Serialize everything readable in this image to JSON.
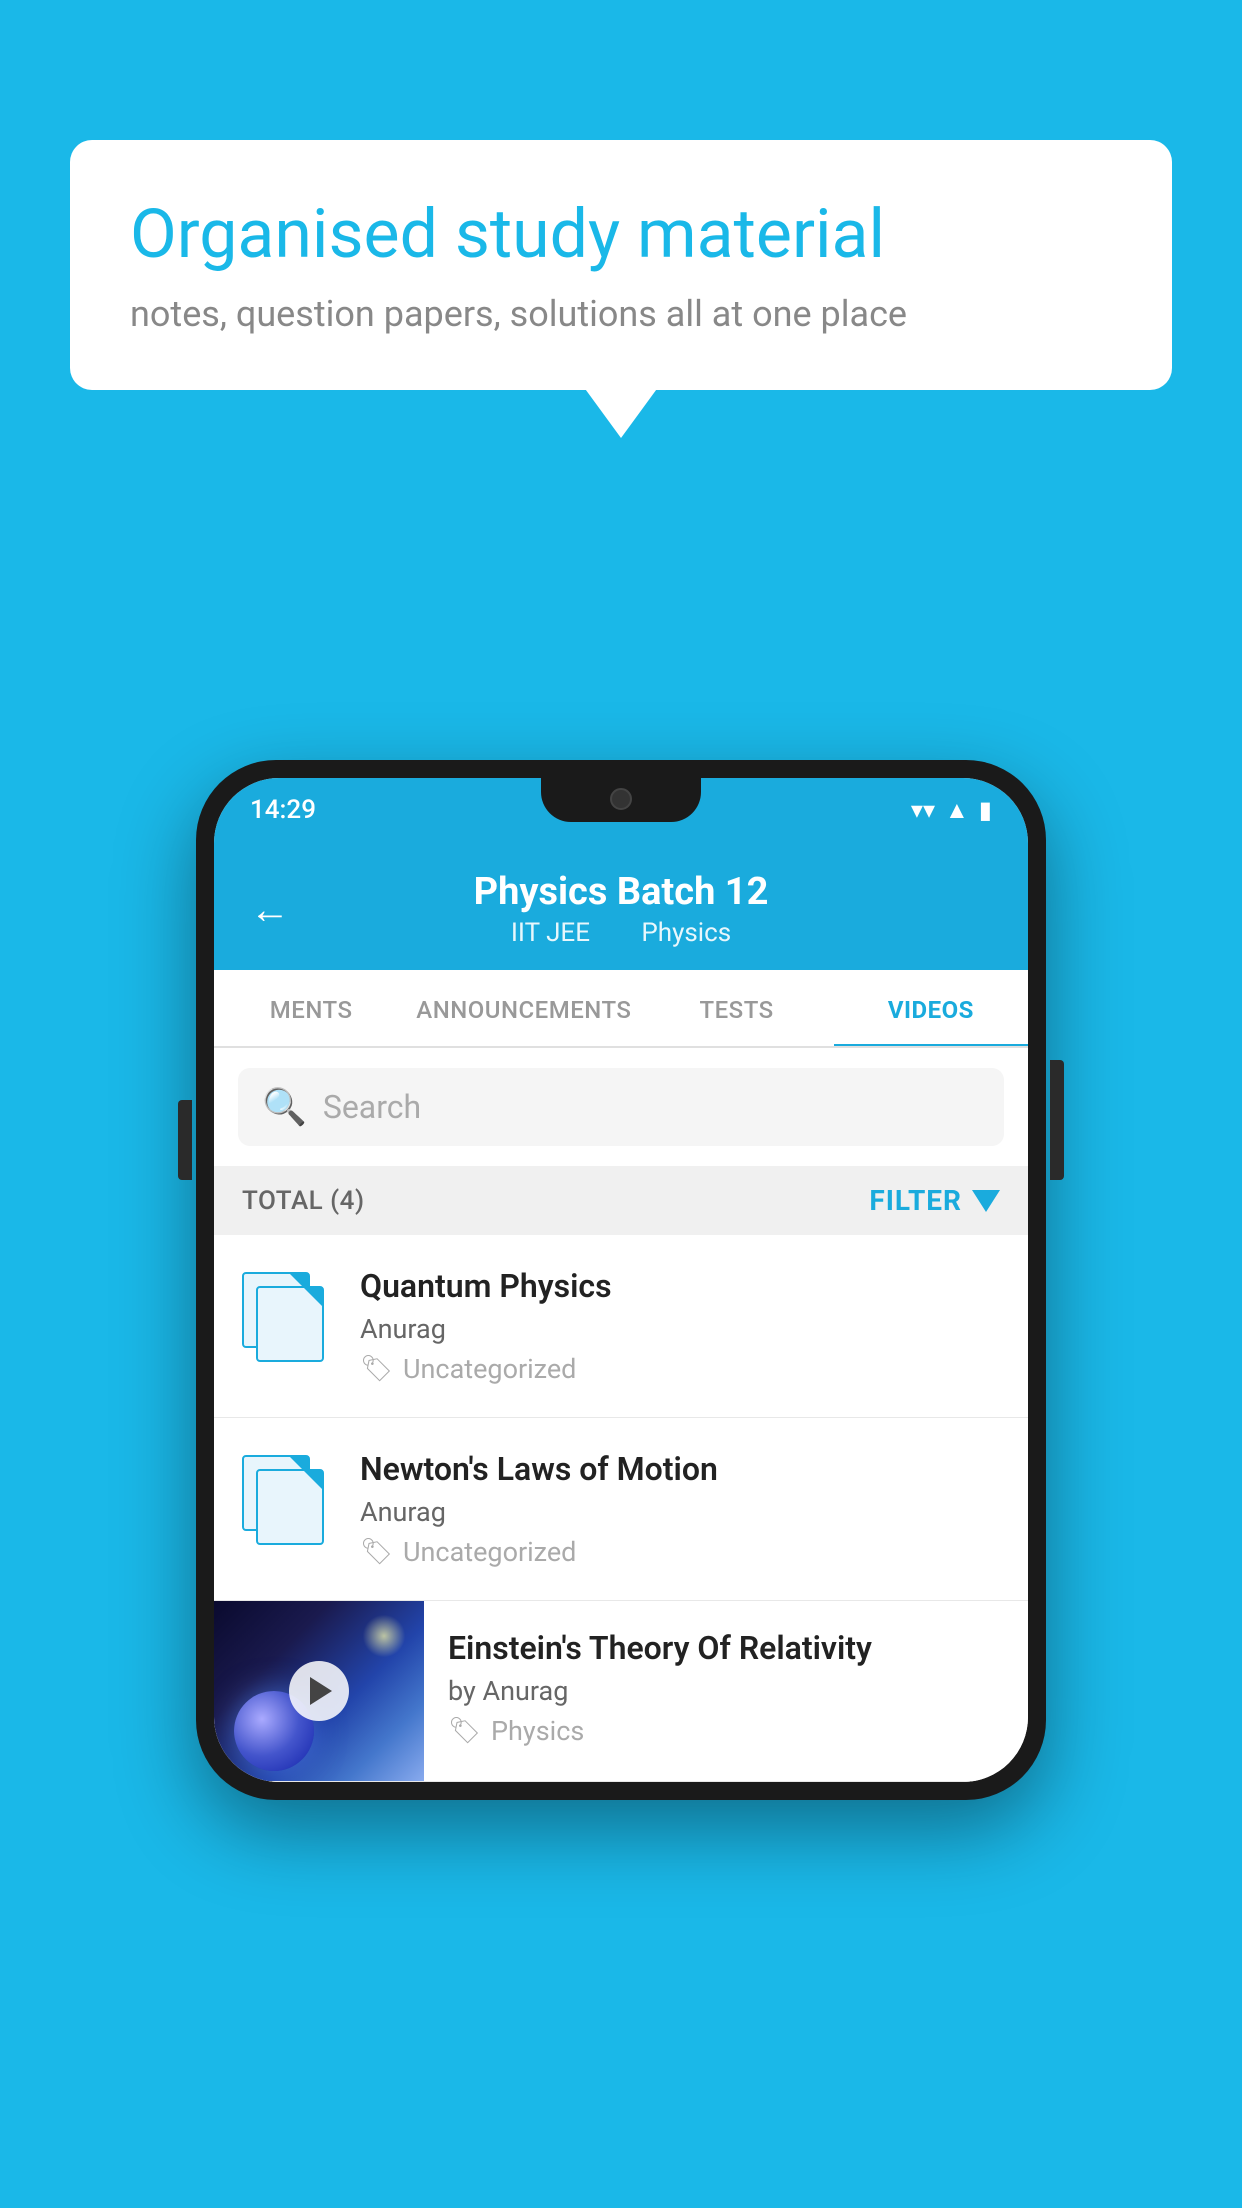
{
  "background_color": "#1ab8e8",
  "speech_bubble": {
    "title": "Organised study material",
    "subtitle": "notes, question papers, solutions all at one place"
  },
  "phone": {
    "status_bar": {
      "time": "14:29",
      "icons": [
        "wifi",
        "signal",
        "battery"
      ]
    },
    "header": {
      "back_label": "←",
      "title": "Physics Batch 12",
      "subtitle_part1": "IIT JEE",
      "subtitle_part2": "Physics"
    },
    "tabs": [
      {
        "label": "MENTS",
        "active": false
      },
      {
        "label": "ANNOUNCEMENTS",
        "active": false
      },
      {
        "label": "TESTS",
        "active": false
      },
      {
        "label": "VIDEOS",
        "active": true
      }
    ],
    "search": {
      "placeholder": "Search"
    },
    "filter_bar": {
      "total_label": "TOTAL (4)",
      "filter_label": "FILTER"
    },
    "videos": [
      {
        "title": "Quantum Physics",
        "author": "Anurag",
        "tag": "Uncategorized",
        "has_thumbnail": false
      },
      {
        "title": "Newton's Laws of Motion",
        "author": "Anurag",
        "tag": "Uncategorized",
        "has_thumbnail": false
      },
      {
        "title": "Einstein's Theory Of Relativity",
        "author": "by Anurag",
        "tag": "Physics",
        "has_thumbnail": true
      }
    ]
  }
}
